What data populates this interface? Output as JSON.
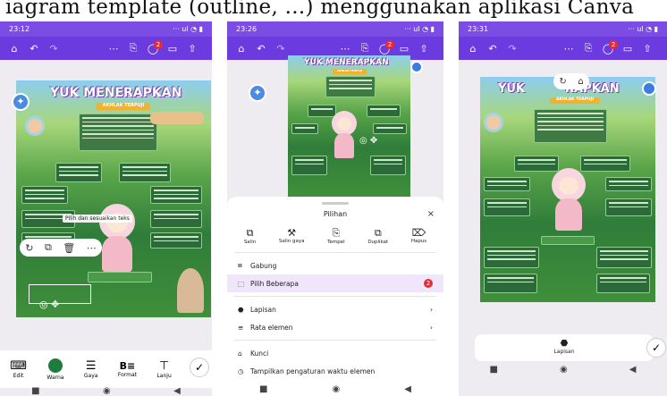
{
  "caption": {
    "text": "iagram template (outline, ...) menggunakan aplikasi Canva"
  },
  "p1": {
    "time": "23:12",
    "signal": "··· ul ◔ ▮",
    "badge": "2",
    "title": "YUK MENERAPKAN",
    "subtitle": "AKHLAK TERPUJI",
    "tooltip": "Pilih dan sesuaikan teks",
    "dock": [
      {
        "icon": "⌨",
        "label": "Edit"
      },
      {
        "icon": "●",
        "label": "Warna"
      },
      {
        "icon": "☰",
        "label": "Gaya"
      },
      {
        "icon": "B≡",
        "label": "Format"
      },
      {
        "icon": "⊤",
        "label": "Lanju"
      }
    ]
  },
  "p2": {
    "time": "23:26",
    "signal": "··· ul ◔ ▮",
    "badge": "2",
    "title": "YUK MENERAPKAN",
    "subtitle": "AKHLAK TERPUJI",
    "sheet_title": "Pilihan",
    "close": "×",
    "actions": [
      {
        "icon": "⧉",
        "label": "Salin"
      },
      {
        "icon": "⚒",
        "label": "Salin gaya"
      },
      {
        "icon": "⎘",
        "label": "Tempel"
      },
      {
        "icon": "⧉",
        "label": "Duplikat"
      },
      {
        "icon": "⌦",
        "label": "Hapus"
      }
    ],
    "menu": [
      {
        "icon": "⧈",
        "label": "Gabung",
        "trail": ""
      },
      {
        "icon": "⬚",
        "label": "Pilih Beberapa",
        "trail": "2"
      },
      {
        "icon": "⬣",
        "label": "Lapisan",
        "trail": "›"
      },
      {
        "icon": "≡",
        "label": "Rata elemen",
        "trail": "›"
      },
      {
        "icon": "⌂",
        "label": "Kunci",
        "trail": ""
      },
      {
        "icon": "◷",
        "label": "Tampilkan pengaturan waktu elemen",
        "trail": ""
      }
    ]
  },
  "p3": {
    "time": "23:31",
    "signal": "··· ul ◔ ▮",
    "badge": "2",
    "title": "YUK",
    "title2": "RAPKAN",
    "subtitle": "AKHLAK TERPUJI",
    "lapisan": "Lapisan",
    "lapisan_icon": "⬣"
  },
  "nav": {
    "square": "■",
    "circle": "◉",
    "back": "◀"
  },
  "colors": {
    "toolbar": "#6b3be0",
    "accent": "#8b3de0",
    "poster_green": "#2f7d3a"
  }
}
